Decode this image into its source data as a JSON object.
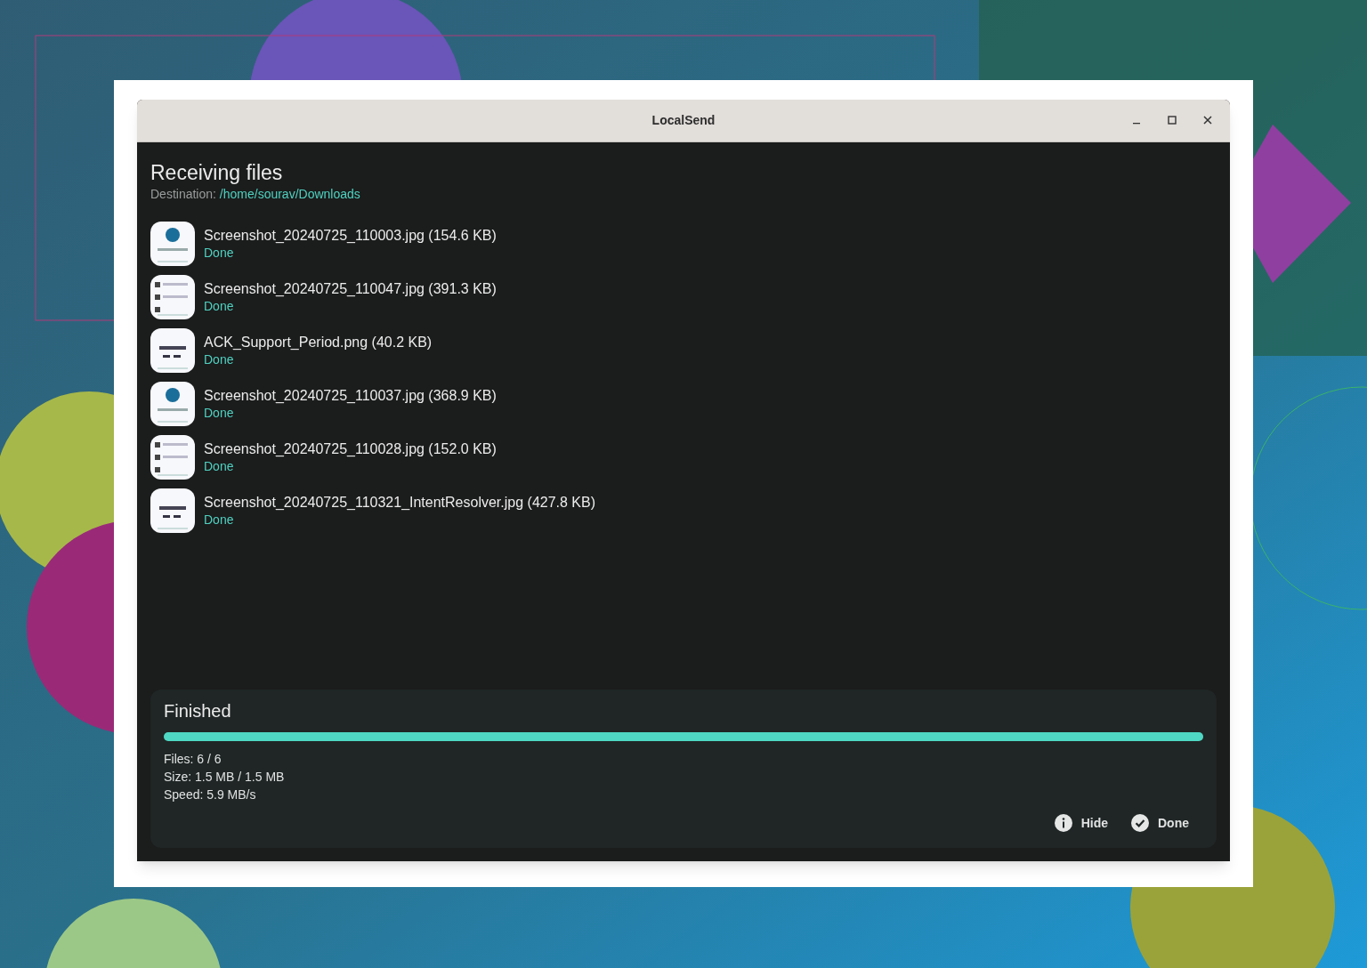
{
  "window": {
    "title": "LocalSend"
  },
  "heading": "Receiving files",
  "destination": {
    "label": "Destination:",
    "path": "/home/sourav/Downloads"
  },
  "files": [
    {
      "name": "Screenshot_20240725_110003.jpg (154.6 KB)",
      "status": "Done"
    },
    {
      "name": "Screenshot_20240725_110047.jpg (391.3 KB)",
      "status": "Done"
    },
    {
      "name": "ACK_Support_Period.png (40.2 KB)",
      "status": "Done"
    },
    {
      "name": "Screenshot_20240725_110037.jpg (368.9 KB)",
      "status": "Done"
    },
    {
      "name": "Screenshot_20240725_110028.jpg (152.0 KB)",
      "status": "Done"
    },
    {
      "name": "Screenshot_20240725_110321_IntentResolver.jpg (427.8 KB)",
      "status": "Done"
    }
  ],
  "progress": {
    "title": "Finished",
    "level": 1,
    "stats": [
      "Files: 6 / 6",
      "Size: 1.5 MB / 1.5 MB",
      "Speed: 5.9 MB/s"
    ]
  },
  "actions": [
    {
      "label": "Hide",
      "kind": "info"
    },
    {
      "label": "Done",
      "kind": "check"
    }
  ]
}
